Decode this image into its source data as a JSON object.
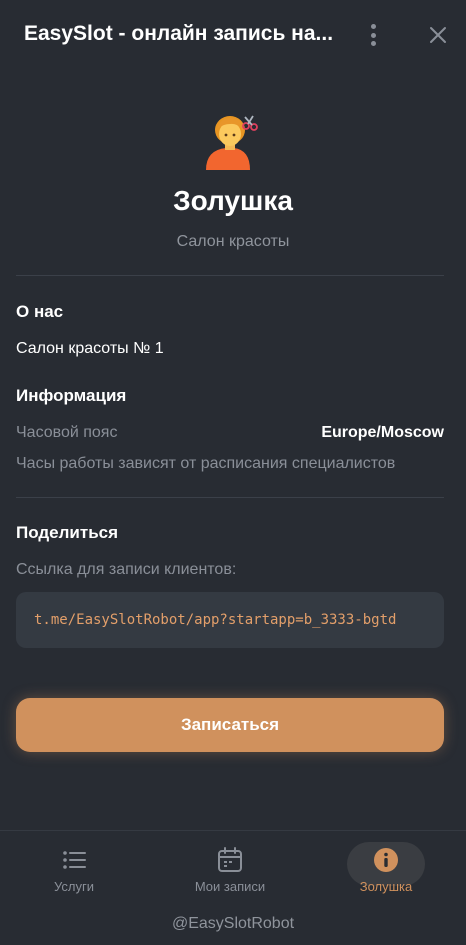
{
  "header": {
    "title": "EasySlot - онлайн запись на..."
  },
  "profile": {
    "avatar_icon": "hairdresser-emoji-icon",
    "name": "Золушка",
    "type": "Салон красоты"
  },
  "about": {
    "title": "О нас",
    "text": "Салон красоты № 1"
  },
  "info": {
    "title": "Информация",
    "timezone_label": "Часовой пояс",
    "timezone_value": "Europe/Moscow",
    "hours_note": "Часы работы зависят от расписания специалистов"
  },
  "share": {
    "title": "Поделиться",
    "link_label": "Ссылка для записи клиентов:",
    "link": "t.me/EasySlotRobot/app?startapp=b_3333-bgtd"
  },
  "actions": {
    "book_label": "Записаться"
  },
  "nav": {
    "items": [
      {
        "label": "Услуги",
        "icon": "list-icon",
        "active": false
      },
      {
        "label": "Мои записи",
        "icon": "calendar-icon",
        "active": false
      },
      {
        "label": "Золушка",
        "icon": "info-icon",
        "active": true
      }
    ]
  },
  "footer": {
    "bot_handle": "@EasySlotRobot"
  },
  "colors": {
    "background": "#282c33",
    "accent": "#d0915d",
    "link": "#e39f6a",
    "muted": "#8a8f98"
  }
}
